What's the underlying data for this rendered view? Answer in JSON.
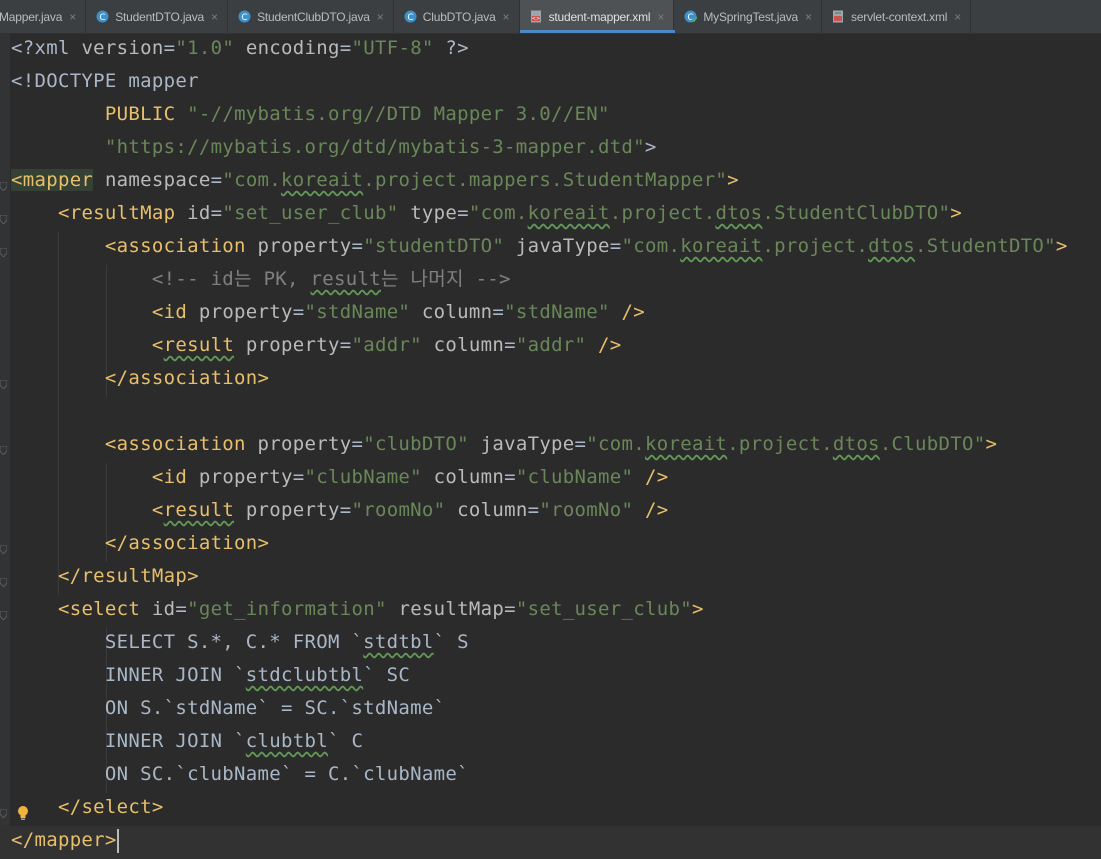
{
  "tabs": [
    {
      "label": "Mapper.java",
      "icon": "java-interface-icon",
      "active": false,
      "first": true
    },
    {
      "label": "StudentDTO.java",
      "icon": "java-class-icon",
      "active": false
    },
    {
      "label": "StudentClubDTO.java",
      "icon": "java-class-icon",
      "active": false
    },
    {
      "label": "ClubDTO.java",
      "icon": "java-class-icon",
      "active": false
    },
    {
      "label": "student-mapper.xml",
      "icon": "xml-file-icon",
      "active": true
    },
    {
      "label": "MySpringTest.java",
      "icon": "java-test-icon",
      "active": false
    },
    {
      "label": "servlet-context.xml",
      "icon": "xml-config-icon",
      "active": false
    }
  ],
  "close_glyph": "×",
  "colors": {
    "background": "#2b2b2b",
    "tag": "#e8bf6a",
    "attr_name": "#bababa",
    "attr_value": "#6a8759",
    "comment": "#808080",
    "text": "#a9b7c6",
    "tab_active_underline": "#4a88c7"
  },
  "code_lines": [
    [
      [
        "pl",
        "<?xml "
      ],
      [
        "at",
        "version"
      ],
      [
        "pl",
        "="
      ],
      [
        "av",
        "\"1.0\""
      ],
      [
        "pl",
        " "
      ],
      [
        "at",
        "encoding"
      ],
      [
        "pl",
        "="
      ],
      [
        "av",
        "\"UTF-8\""
      ],
      [
        "pl",
        " ?>"
      ]
    ],
    [
      [
        "pl",
        "<!DOCTYPE mapper"
      ]
    ],
    [
      [
        "pl",
        "        "
      ],
      [
        "dt",
        "PUBLIC"
      ],
      [
        "pl",
        " "
      ],
      [
        "av",
        "\"-//mybatis.org//DTD Mapper 3.0//EN\""
      ]
    ],
    [
      [
        "pl",
        "        "
      ],
      [
        "av",
        "\"https://mybatis.org/dtd/mybatis-3-mapper.dtd\""
      ],
      [
        "pl",
        ">"
      ]
    ],
    [
      [
        "tg",
        "<mapper"
      ],
      [
        "pl",
        " "
      ],
      [
        "at",
        "namespace"
      ],
      [
        "pl",
        "="
      ],
      [
        "av",
        "\"com.koreait.project.mappers.StudentMapper\""
      ],
      [
        "tg",
        ">"
      ]
    ],
    [
      [
        "pl",
        "    "
      ],
      [
        "tg",
        "<resultMap"
      ],
      [
        "pl",
        " "
      ],
      [
        "at",
        "id"
      ],
      [
        "pl",
        "="
      ],
      [
        "av",
        "\"set_user_club\""
      ],
      [
        "pl",
        " "
      ],
      [
        "at",
        "type"
      ],
      [
        "pl",
        "="
      ],
      [
        "av",
        "\"com.koreait.project.dtos.StudentClubDTO\""
      ],
      [
        "tg",
        ">"
      ]
    ],
    [
      [
        "pl",
        "        "
      ],
      [
        "tg",
        "<association"
      ],
      [
        "pl",
        " "
      ],
      [
        "at",
        "property"
      ],
      [
        "pl",
        "="
      ],
      [
        "av",
        "\"studentDTO\""
      ],
      [
        "pl",
        " "
      ],
      [
        "at",
        "javaType"
      ],
      [
        "pl",
        "="
      ],
      [
        "av",
        "\"com.koreait.project.dtos.StudentDTO\""
      ],
      [
        "tg",
        ">"
      ]
    ],
    [
      [
        "pl",
        "            "
      ],
      [
        "cm",
        "<!-- id는 PK, result는 나머지 -->"
      ]
    ],
    [
      [
        "pl",
        "            "
      ],
      [
        "tg",
        "<id"
      ],
      [
        "pl",
        " "
      ],
      [
        "at",
        "property"
      ],
      [
        "pl",
        "="
      ],
      [
        "av",
        "\"stdName\""
      ],
      [
        "pl",
        " "
      ],
      [
        "at",
        "column"
      ],
      [
        "pl",
        "="
      ],
      [
        "av",
        "\"stdName\""
      ],
      [
        "pl",
        " "
      ],
      [
        "tg",
        "/>"
      ]
    ],
    [
      [
        "pl",
        "            "
      ],
      [
        "tg",
        "<result"
      ],
      [
        "pl",
        " "
      ],
      [
        "at",
        "property"
      ],
      [
        "pl",
        "="
      ],
      [
        "av",
        "\"addr\""
      ],
      [
        "pl",
        " "
      ],
      [
        "at",
        "column"
      ],
      [
        "pl",
        "="
      ],
      [
        "av",
        "\"addr\""
      ],
      [
        "pl",
        " "
      ],
      [
        "tg",
        "/>"
      ]
    ],
    [
      [
        "pl",
        "        "
      ],
      [
        "tg",
        "</association>"
      ]
    ],
    [],
    [
      [
        "pl",
        "        "
      ],
      [
        "tg",
        "<association"
      ],
      [
        "pl",
        " "
      ],
      [
        "at",
        "property"
      ],
      [
        "pl",
        "="
      ],
      [
        "av",
        "\"clubDTO\""
      ],
      [
        "pl",
        " "
      ],
      [
        "at",
        "javaType"
      ],
      [
        "pl",
        "="
      ],
      [
        "av",
        "\"com.koreait.project.dtos.ClubDTO\""
      ],
      [
        "tg",
        ">"
      ]
    ],
    [
      [
        "pl",
        "            "
      ],
      [
        "tg",
        "<id"
      ],
      [
        "pl",
        " "
      ],
      [
        "at",
        "property"
      ],
      [
        "pl",
        "="
      ],
      [
        "av",
        "\"clubName\""
      ],
      [
        "pl",
        " "
      ],
      [
        "at",
        "column"
      ],
      [
        "pl",
        "="
      ],
      [
        "av",
        "\"clubName\""
      ],
      [
        "pl",
        " "
      ],
      [
        "tg",
        "/>"
      ]
    ],
    [
      [
        "pl",
        "            "
      ],
      [
        "tg",
        "<result"
      ],
      [
        "pl",
        " "
      ],
      [
        "at",
        "property"
      ],
      [
        "pl",
        "="
      ],
      [
        "av",
        "\"roomNo\""
      ],
      [
        "pl",
        " "
      ],
      [
        "at",
        "column"
      ],
      [
        "pl",
        "="
      ],
      [
        "av",
        "\"roomNo\""
      ],
      [
        "pl",
        " "
      ],
      [
        "tg",
        "/>"
      ]
    ],
    [
      [
        "pl",
        "        "
      ],
      [
        "tg",
        "</association>"
      ]
    ],
    [
      [
        "pl",
        "    "
      ],
      [
        "tg",
        "</resultMap>"
      ]
    ],
    [
      [
        "pl",
        "    "
      ],
      [
        "tg",
        "<select"
      ],
      [
        "pl",
        " "
      ],
      [
        "at",
        "id"
      ],
      [
        "pl",
        "="
      ],
      [
        "av",
        "\"get_information\""
      ],
      [
        "pl",
        " "
      ],
      [
        "at",
        "resultMap"
      ],
      [
        "pl",
        "="
      ],
      [
        "av",
        "\"set_user_club\""
      ],
      [
        "tg",
        ">"
      ]
    ],
    [
      [
        "pl",
        "        SELECT S.*, C.* FROM `stdtbl` S"
      ]
    ],
    [
      [
        "pl",
        "        INNER JOIN `stdclubtbl` SC"
      ]
    ],
    [
      [
        "pl",
        "        ON S.`stdName` = SC.`stdName`"
      ]
    ],
    [
      [
        "pl",
        "        INNER JOIN `clubtbl` C"
      ]
    ],
    [
      [
        "pl",
        "        ON SC.`clubName` = C.`clubName`"
      ]
    ],
    [
      [
        "pl",
        "    "
      ],
      [
        "tg",
        "</select>"
      ]
    ],
    [
      [
        "tg",
        "</mapper>"
      ]
    ]
  ]
}
